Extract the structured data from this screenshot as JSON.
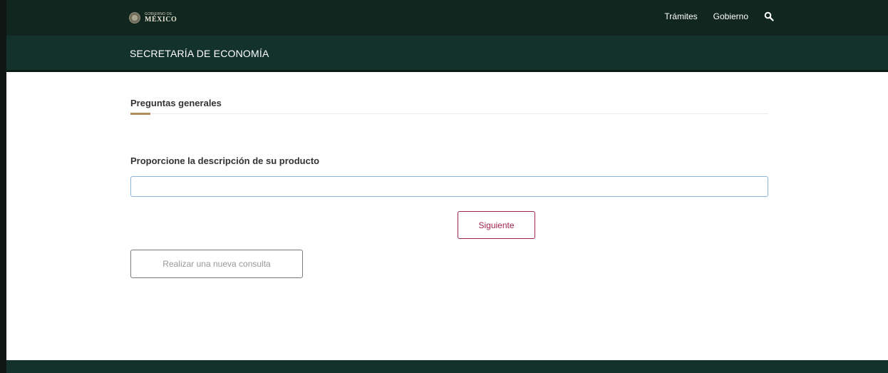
{
  "header": {
    "logo": {
      "small": "GOBIERNO DE",
      "big": "MÉXICO"
    },
    "nav": [
      {
        "label": "Trámites"
      },
      {
        "label": "Gobierno"
      }
    ],
    "search_icon": "search-icon"
  },
  "subheader": {
    "title": "SECRETARÍA DE ECONOMÍA"
  },
  "main": {
    "section_title": "Preguntas generales",
    "field_label": "Proporcione la descripción de su producto",
    "field_value": "",
    "next_button": "Siguiente",
    "new_query_button": "Realizar una nueva consulta"
  },
  "colors": {
    "topbar": "#122620",
    "subbar": "#13322b",
    "accent_gold": "#b38e5d",
    "accent_wine": "#9d2449"
  }
}
